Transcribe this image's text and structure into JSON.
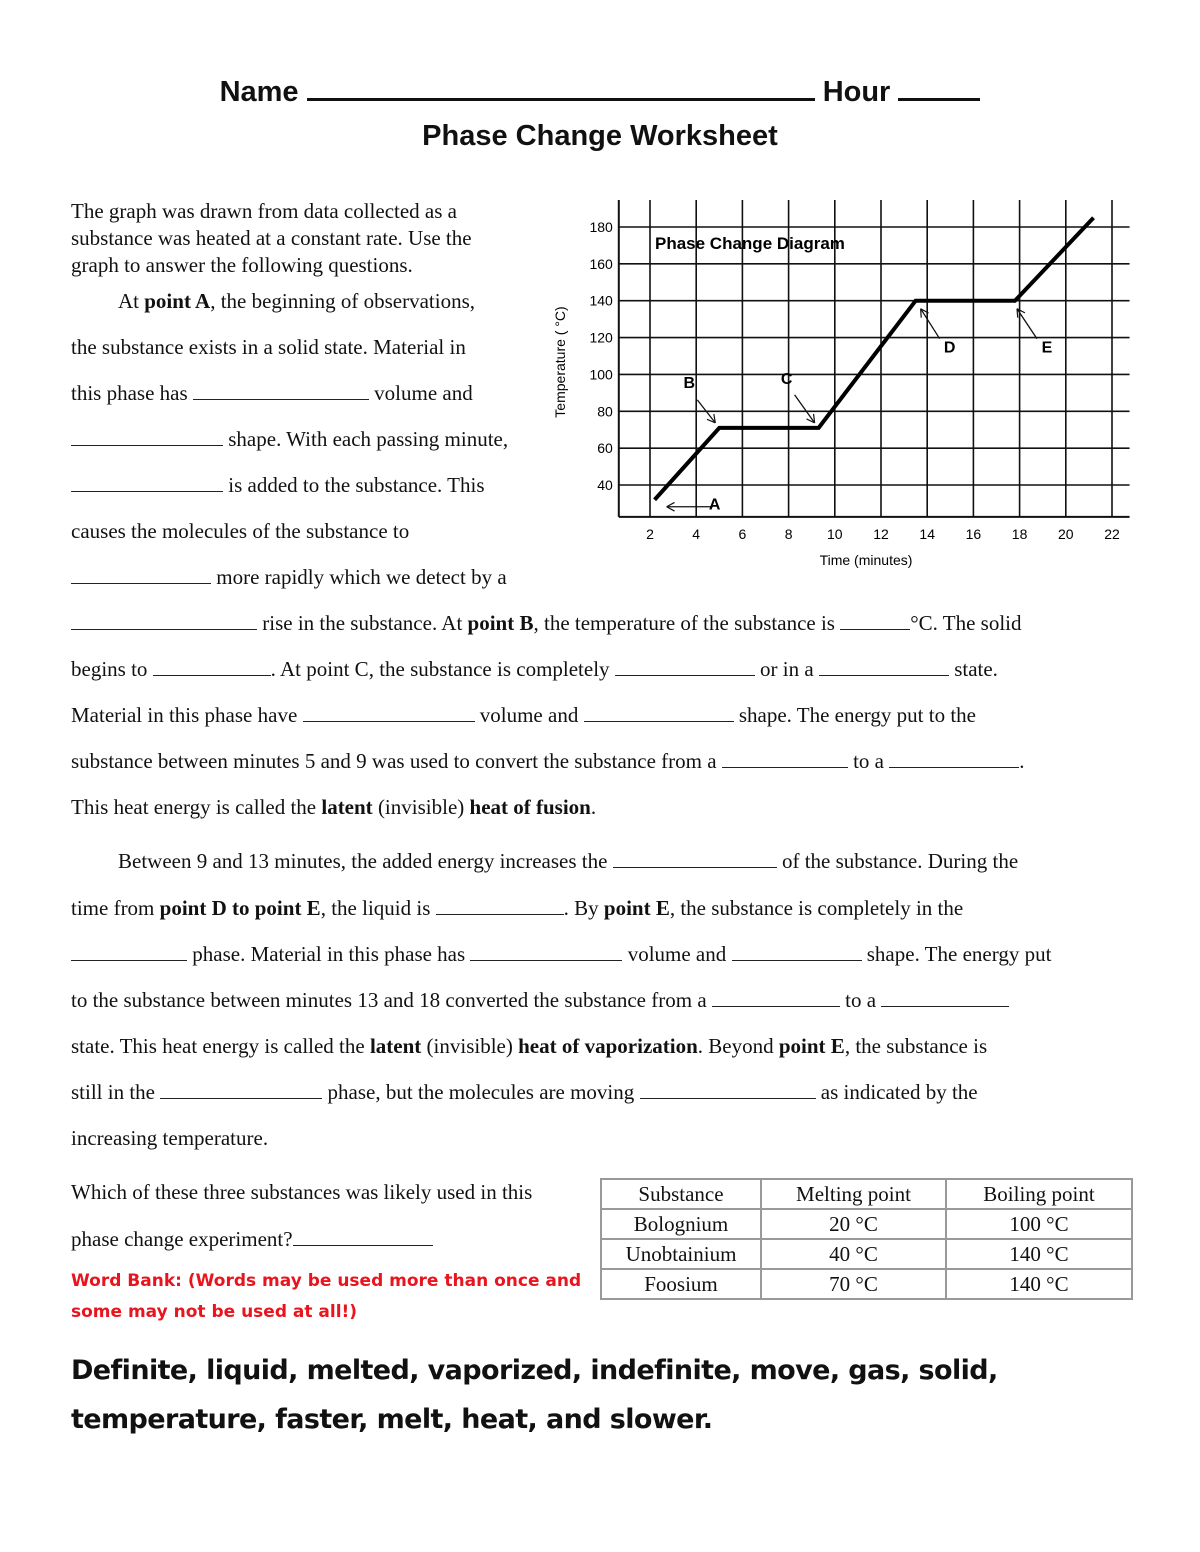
{
  "header": {
    "name_label": "Name",
    "hour_label": "Hour",
    "title": "Phase Change Worksheet"
  },
  "intro": {
    "line1": "The graph was drawn from data collected as a",
    "line2": "substance was heated at a constant rate. Use the",
    "line3": "graph to answer the following questions."
  },
  "para1": {
    "l1_a": "At ",
    "l1_b": "point A",
    "l1_c": ", the beginning of observations,",
    "l2": "the substance exists in a solid state. Material in",
    "l3_a": "this phase has ",
    "l3_b": " volume and",
    "l4": " shape. With each passing minute,",
    "l5": " is added to the substance. This",
    "l6": "causes the molecules of the substance to",
    "l7": " more rapidly which we detect by a",
    "l8_a": " rise in the substance. At ",
    "l8_b": "point B",
    "l8_c": ", the temperature of the substance is ",
    "l8_d": "°C. The solid",
    "l9_a": "begins to ",
    "l9_b": ". At point C, the substance is completely ",
    "l9_c": " or in a ",
    "l9_d": " state.",
    "l10_a": "Material in this phase have ",
    "l10_b": " volume and ",
    "l10_c": " shape. The energy put to the",
    "l11_a": "substance between minutes 5 and 9 was used to convert the substance from a ",
    "l11_b": " to a ",
    "l11_c": ".",
    "l12_a": "This heat energy is called the ",
    "l12_b": "latent",
    "l12_c": " (invisible) ",
    "l12_d": "heat of fusion",
    "l12_e": "."
  },
  "para2": {
    "l1_a": "Between 9 and 13 minutes, the added energy increases the ",
    "l1_b": " of the substance. During the",
    "l2_a": "time from ",
    "l2_b": "point D to point E",
    "l2_c": ", the liquid is ",
    "l2_d": ". By ",
    "l2_e": "point E",
    "l2_f": ", the substance is completely in the",
    "l3_a": " phase. Material in this phase has ",
    "l3_b": " volume and ",
    "l3_c": " shape. The energy put",
    "l4_a": "to the substance between minutes 13 and 18 converted the substance from a ",
    "l4_b": " to a ",
    "l5_a": "state. This heat energy is called the ",
    "l5_b": "latent",
    "l5_c": " (invisible) ",
    "l5_d": "heat of vaporization",
    "l5_e": ". Beyond ",
    "l5_f": "point E",
    "l5_g": ", the substance is",
    "l6_a": "still in the ",
    "l6_b": " phase, but the molecules are moving ",
    "l6_c": " as indicated by the",
    "l7": "increasing temperature."
  },
  "question": {
    "l1": "Which of these three substances was likely used in this",
    "l2": "phase change experiment?"
  },
  "word_bank": {
    "label_l1": "Word Bank:   (Words may be used more than once and",
    "label_l2": "some may not be used at all!)",
    "words_l1": "Definite,  liquid,  melted, vaporized, indefinite,  move, gas,  solid,",
    "words_l2": "temperature, faster, melt, heat, and slower.",
    "color": "#e8141e"
  },
  "table": {
    "headers": [
      "Substance",
      "Melting point",
      "Boiling point"
    ],
    "rows": [
      [
        "Bolognium",
        "20 °C",
        "100 °C"
      ],
      [
        "Unobtainium",
        "40 °C",
        "140 °C"
      ],
      [
        "Foosium",
        "70 °C",
        "140 °C"
      ]
    ]
  },
  "chart_data": {
    "type": "line",
    "title": "Phase Change Diagram",
    "xlabel": "Time (minutes)",
    "ylabel": "Temperature ( °C)",
    "xlim": [
      0,
      22.5
    ],
    "ylim": [
      20,
      195
    ],
    "xticks": [
      "2",
      "4",
      "6",
      "8",
      "10",
      "12",
      "14",
      "16",
      "18",
      "20",
      "22"
    ],
    "yticks": [
      "40",
      "60",
      "80",
      "100",
      "120",
      "140",
      "160",
      "180"
    ],
    "grid": true,
    "series": [
      {
        "name": "Temperature",
        "x": [
          2.2,
          5.0,
          9.3,
          13.5,
          17.8,
          21.2
        ],
        "y": [
          32,
          71,
          71,
          140,
          140,
          185
        ]
      }
    ],
    "annotations": [
      {
        "label": "A",
        "x": 2.2,
        "y": 32
      },
      {
        "label": "B",
        "x": 5.0,
        "y": 71
      },
      {
        "label": "C",
        "x": 9.3,
        "y": 71
      },
      {
        "label": "D",
        "x": 13.5,
        "y": 140
      },
      {
        "label": "E",
        "x": 17.8,
        "y": 140
      }
    ]
  }
}
